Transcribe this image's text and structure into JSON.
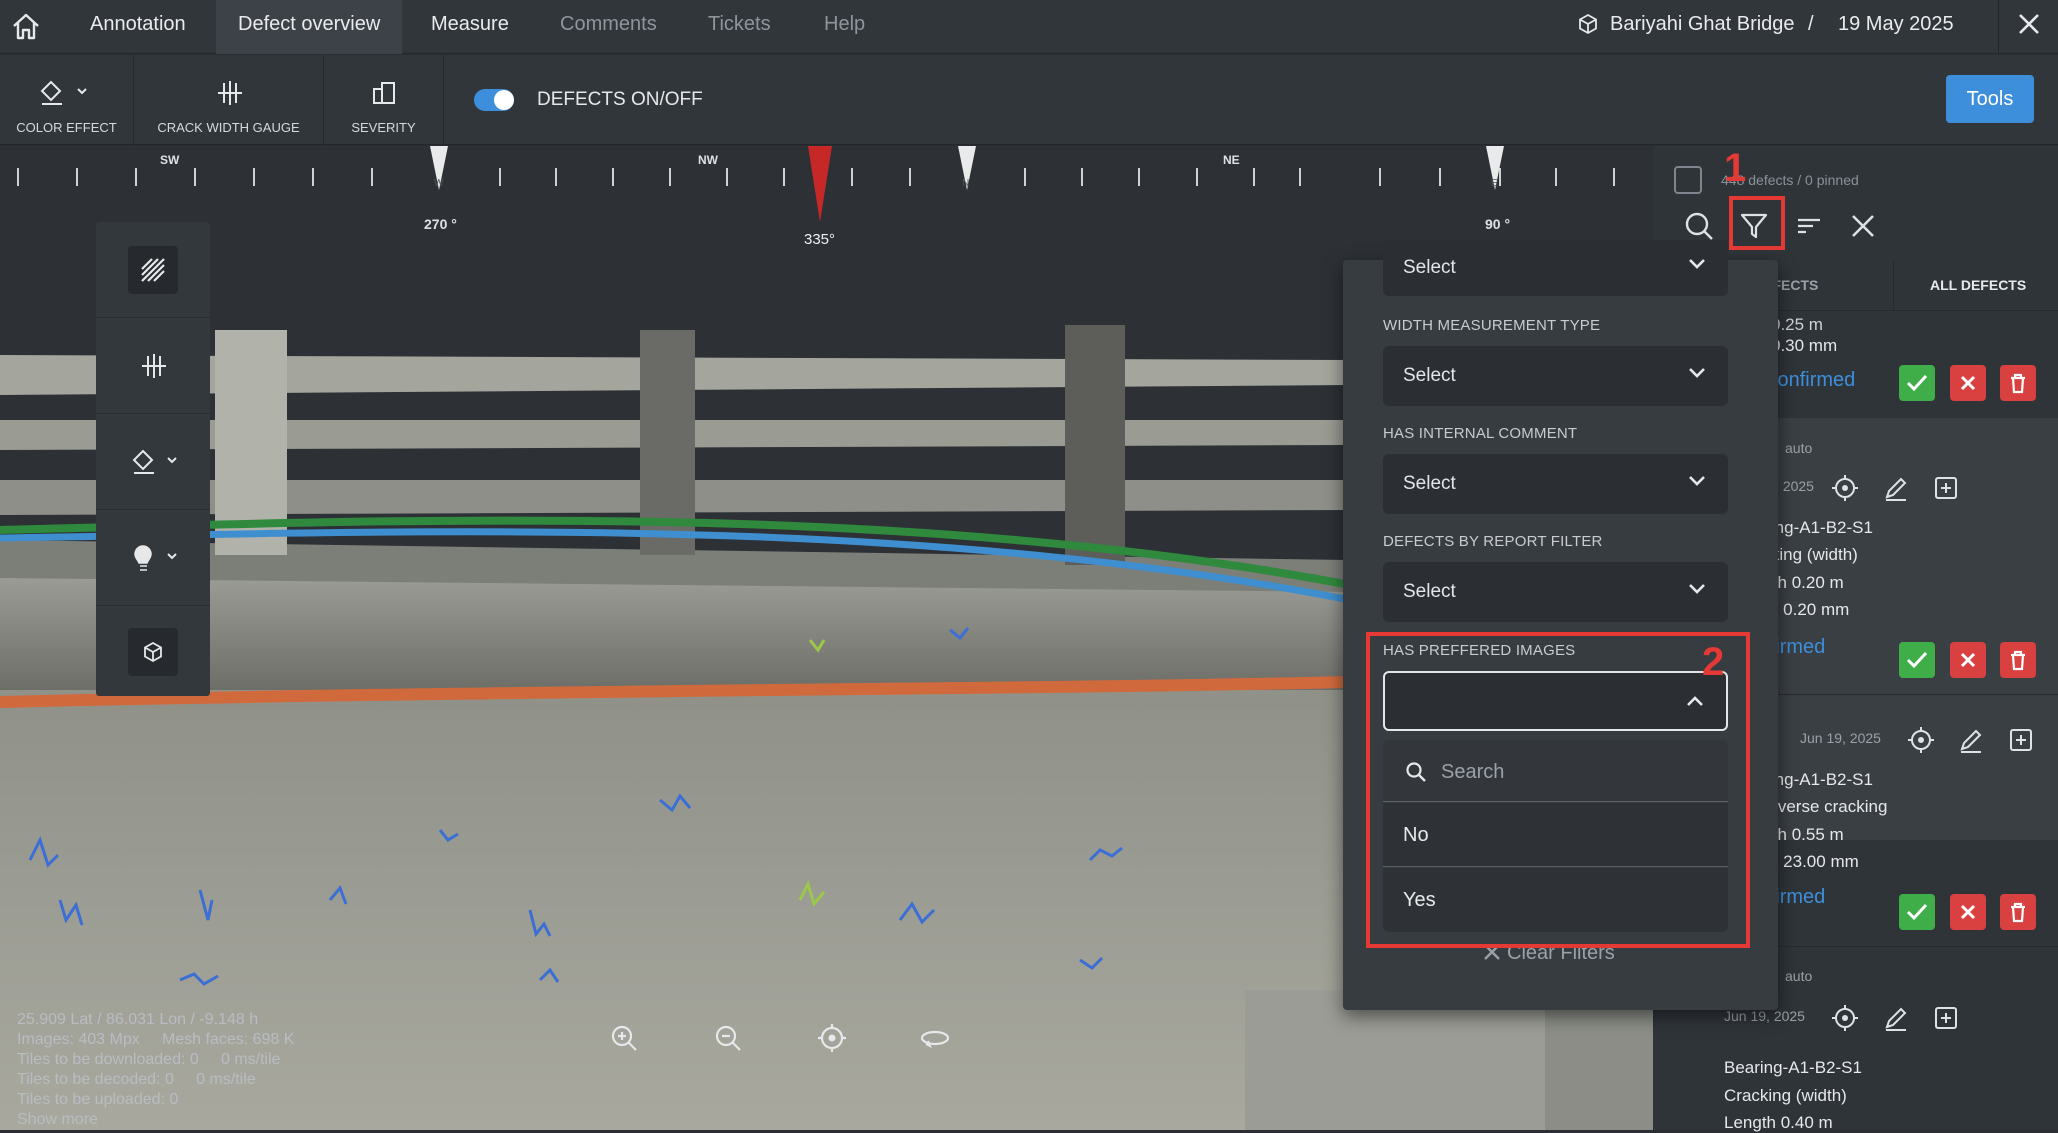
{
  "nav": {
    "tabs": [
      "Annotation",
      "Defect overview",
      "Measure",
      "Comments",
      "Tickets",
      "Help"
    ],
    "project": "Bariyahi Ghat Bridge",
    "separator": "/",
    "date": "19 May 2025"
  },
  "toolbar": {
    "color_effect": "COLOR EFFECT",
    "crack_width_gauge": "CRACK WIDTH GAUGE",
    "severity": "SEVERITY",
    "defects_toggle": "DEFECTS ON/OFF",
    "tools": "Tools"
  },
  "compass": {
    "sw": "SW",
    "nw": "NW",
    "ne": "NE",
    "w": "W",
    "n": "N",
    "e": "E",
    "deg270": "270 °",
    "deg335": "335°",
    "deg90": "90 °"
  },
  "status": {
    "line1": "25.909 Lat / 86.031 Lon / -9.148 h",
    "line2": "Images: 403 Mpx     Mesh faces: 698 K",
    "line3": "Tiles to be downloaded: 0     0 ms/tile",
    "line4": "Tiles to be decoded: 0     0 ms/tile",
    "line5": "Tiles to be uploaded: 0",
    "line6": "Show more"
  },
  "panel": {
    "count": "448 defects / 0 pinned",
    "tab_other": "DEFECTS",
    "tab_all": "ALL DEFECTS",
    "annot1": "1",
    "annot2": "2",
    "card1": {
      "l1": "0.25 m",
      "l2": "0.30 mm",
      "status": "Confirmed"
    },
    "card2": {
      "src": "auto",
      "date": "Jun 19, 2025",
      "l1": "Bearing-A1-B2-S1",
      "l2": "Cracking (width)",
      "l3": "Length 0.20 m",
      "l4": "Width 0.20 mm",
      "status": "Confirmed"
    },
    "card3": {
      "date": "Jun 19, 2025",
      "l1": "Bearing-A1-B2-S1",
      "l2": "Transverse cracking",
      "l3": "Length 0.55 m",
      "l4": "Width 23.00 mm",
      "status": "Confirmed"
    },
    "card4": {
      "src": "auto",
      "date": "Jun 19, 2025",
      "l1": "Bearing-A1-B2-S1",
      "l2": "Cracking (width)",
      "l3": "Length 0.40 m"
    }
  },
  "filter": {
    "top_select": "Select",
    "width_label": "WIDTH MEASUREMENT TYPE",
    "width_value": "Select",
    "comment_label": "HAS INTERNAL COMMENT",
    "comment_value": "Select",
    "report_label": "DEFECTS BY REPORT FILTER",
    "report_value": "Select",
    "images_label": "HAS PREFFERED IMAGES",
    "search_placeholder": "Search",
    "options": [
      "No",
      "Yes"
    ],
    "clear": "Clear Filters"
  },
  "colors": {
    "accent": "#3d8fdc",
    "confirm": "#3fae49",
    "reject": "#d94040",
    "annotation": "#e53935"
  }
}
